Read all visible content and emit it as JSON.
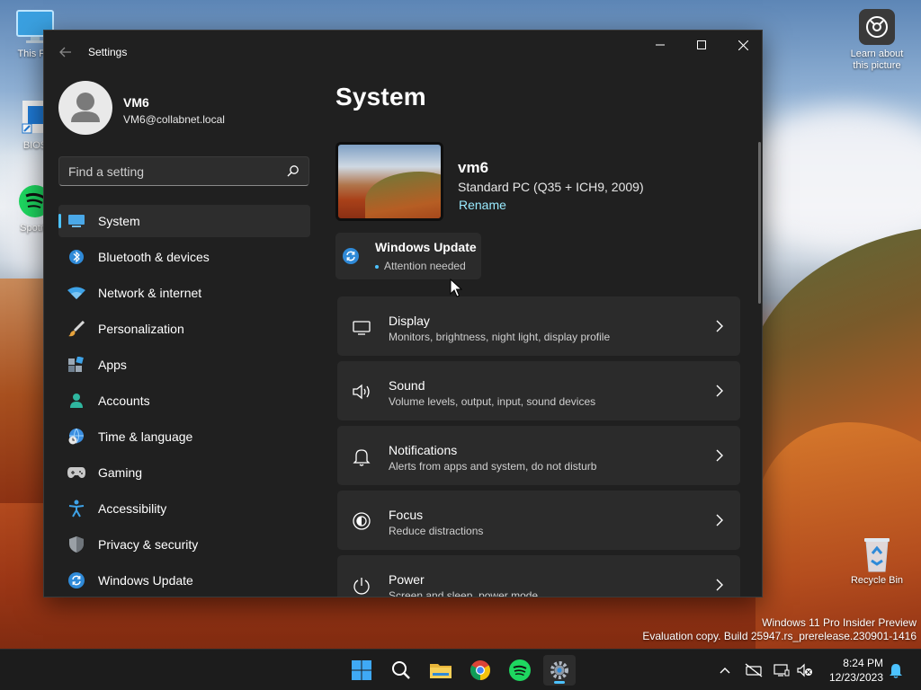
{
  "desktop": {
    "icons": [
      {
        "label": "This PC",
        "icon": "monitor-icon"
      },
      {
        "label": "BIOS",
        "icon": "shortcut-icon"
      },
      {
        "label": "Spotify",
        "icon": "spotify-icon"
      },
      {
        "label": "Learn about\nthis picture",
        "icon": "camera-icon"
      },
      {
        "label": "Recycle Bin",
        "icon": "recycle-bin-icon"
      }
    ]
  },
  "watermark": {
    "line1": "Windows 11 Pro Insider Preview",
    "line2": "Evaluation copy. Build 25947.rs_prerelease.230901-1416"
  },
  "window": {
    "title": "Settings",
    "user": {
      "name": "VM6",
      "email": "VM6@collabnet.local"
    },
    "search": {
      "placeholder": "Find a setting"
    },
    "nav": [
      {
        "label": "System",
        "icon": "system-icon",
        "selected": true
      },
      {
        "label": "Bluetooth & devices",
        "icon": "bluetooth-icon"
      },
      {
        "label": "Network & internet",
        "icon": "wifi-icon"
      },
      {
        "label": "Personalization",
        "icon": "brush-icon"
      },
      {
        "label": "Apps",
        "icon": "apps-icon"
      },
      {
        "label": "Accounts",
        "icon": "accounts-icon"
      },
      {
        "label": "Time & language",
        "icon": "globe-clock-icon"
      },
      {
        "label": "Gaming",
        "icon": "gamepad-icon"
      },
      {
        "label": "Accessibility",
        "icon": "accessibility-icon"
      },
      {
        "label": "Privacy & security",
        "icon": "shield-icon"
      },
      {
        "label": "Windows Update",
        "icon": "update-icon"
      }
    ],
    "main": {
      "title": "System",
      "device": {
        "name": "vm6",
        "model": "Standard PC (Q35 + ICH9, 2009)",
        "rename": "Rename"
      },
      "update": {
        "title": "Windows Update",
        "status": "Attention needed"
      },
      "cards": [
        {
          "title": "Display",
          "subtitle": "Monitors, brightness, night light, display profile",
          "icon": "display-icon"
        },
        {
          "title": "Sound",
          "subtitle": "Volume levels, output, input, sound devices",
          "icon": "speaker-icon"
        },
        {
          "title": "Notifications",
          "subtitle": "Alerts from apps and system, do not disturb",
          "icon": "bell-icon"
        },
        {
          "title": "Focus",
          "subtitle": "Reduce distractions",
          "icon": "focus-icon"
        },
        {
          "title": "Power",
          "subtitle": "Screen and sleep, power mode",
          "icon": "power-icon"
        }
      ]
    }
  },
  "taskbar": {
    "apps": [
      "start-icon",
      "search-icon",
      "file-explorer-icon",
      "chrome-icon",
      "spotify-icon",
      "settings-icon"
    ],
    "clock": {
      "time": "8:24 PM",
      "date": "12/23/2023"
    }
  },
  "colors": {
    "accent": "#4cc2ff",
    "window_bg": "#202020",
    "card_bg": "#2b2b2b",
    "link": "#99ebff"
  }
}
